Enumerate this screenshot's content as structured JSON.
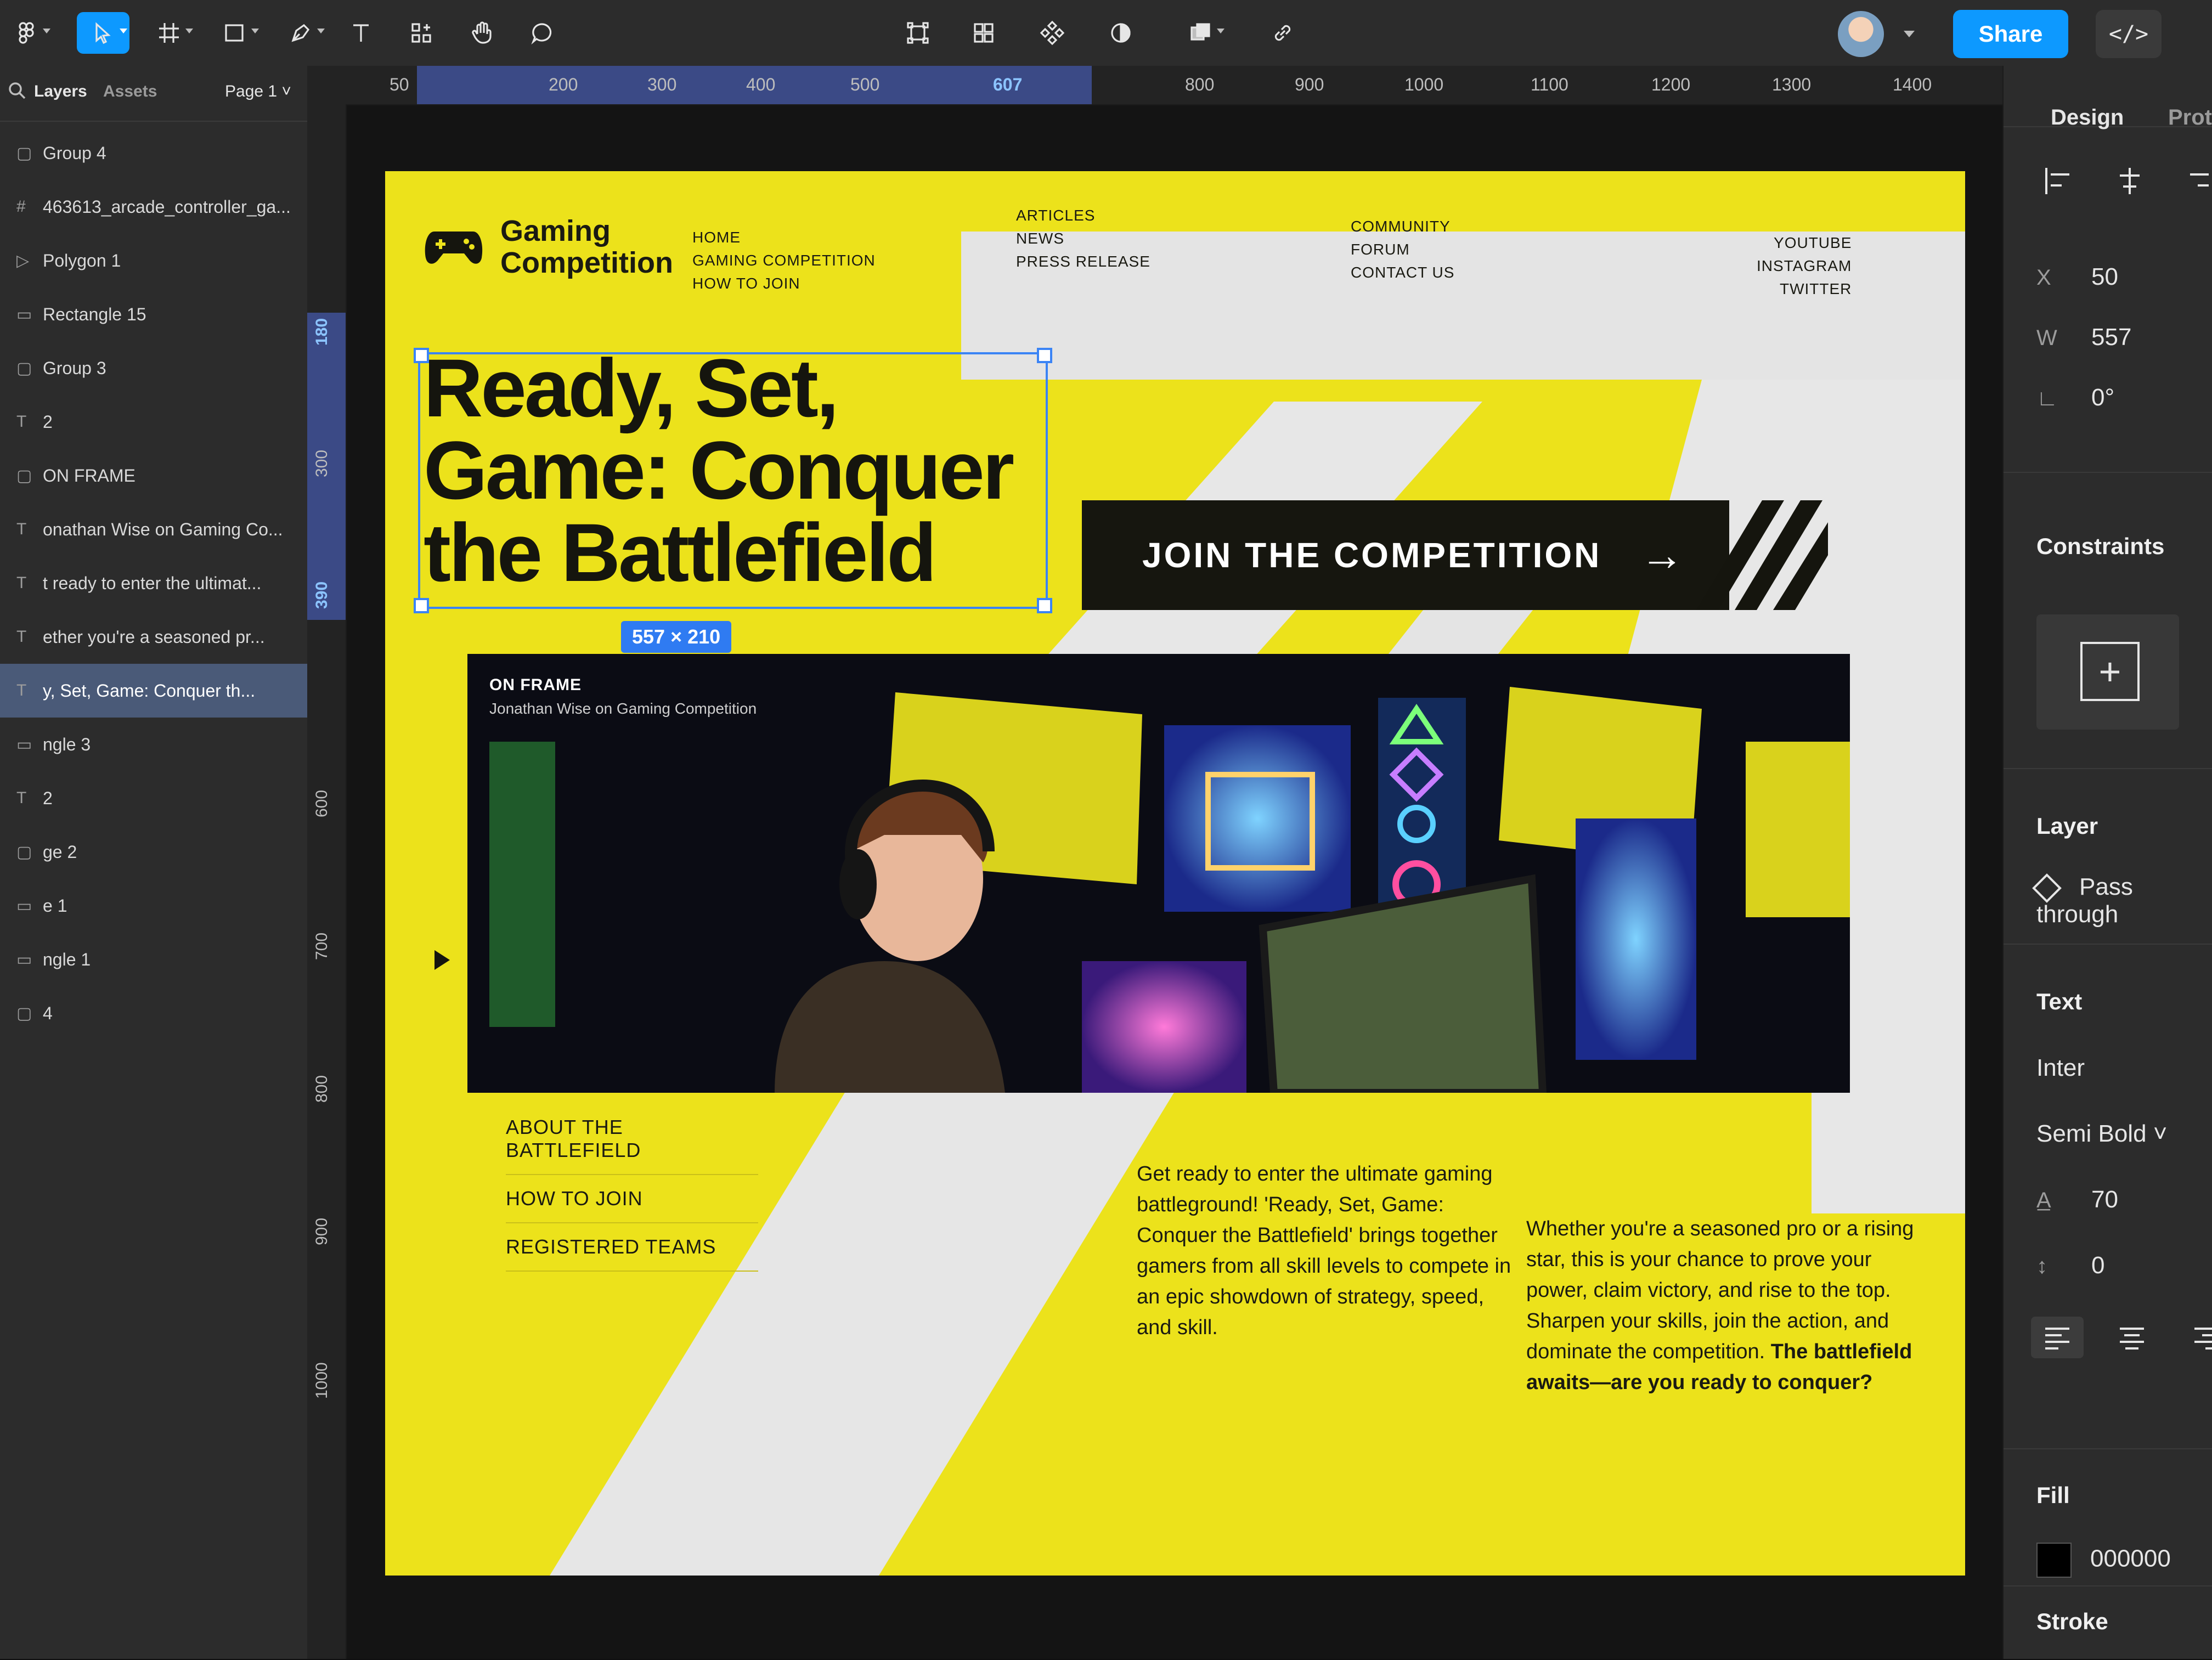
{
  "toolbar": {
    "share_label": "Share",
    "code_label": "</>"
  },
  "left_panel": {
    "tabs": [
      "Layers",
      "Assets"
    ],
    "page": "Page 1",
    "layers": [
      "Group 4",
      "463613_arcade_controller_ga...",
      "Polygon 1",
      "Rectangle 15",
      "Group 3",
      "2",
      "ON FRAME",
      "onathan Wise on Gaming Co...",
      "t ready to enter the ultimat...",
      "ether you're a seasoned pr...",
      "y, Set, Game: Conquer th...",
      "ngle 3",
      "2",
      "ge 2",
      "e 1",
      "ngle 1",
      "4"
    ]
  },
  "rulers": {
    "top": [
      "50",
      "200",
      "300",
      "400",
      "500",
      "607",
      "800",
      "900",
      "1000",
      "1100",
      "1200",
      "1300",
      "1400"
    ],
    "left": [
      "180",
      "300",
      "390",
      "600",
      "700",
      "800",
      "900",
      "1000"
    ]
  },
  "design": {
    "logo_text": "Gaming Competition",
    "nav": {
      "col1": [
        "HOME",
        "GAMING COMPETITION",
        "HOW TO JOIN"
      ],
      "col2": [
        "ARTICLES",
        "NEWS",
        "PRESS RELEASE"
      ],
      "col3": [
        "COMMUNITY",
        "FORUM",
        "CONTACT US"
      ],
      "col4": [
        "YOUTUBE",
        "INSTAGRAM",
        "TWITTER"
      ]
    },
    "headline": "Ready, Set, Game: Conquer the Battlefield",
    "size_tag": "557 × 210",
    "cta_label": "JOIN THE COMPETITION",
    "cta_arrow": "→",
    "photo_tag_title": "ON FRAME",
    "photo_tag_sub": "Jonathan Wise on Gaming Competition",
    "side_links": [
      "ABOUT THE BATTLEFIELD",
      "HOW TO JOIN",
      "REGISTERED TEAMS"
    ],
    "body_left": "Get ready to enter the ultimate gaming battleground! 'Ready, Set, Game: Conquer the Battlefield' brings together gamers from all skill levels to compete in an epic showdown of strategy, speed, and skill.",
    "body_right_plain": "Whether you're a seasoned pro or a rising star, this is your chance to prove your power, claim victory, and rise to the top. Sharpen your skills, join the action, and dominate the competition.",
    "body_right_bold": "The battlefield awaits—are you ready to conquer?"
  },
  "right_panel": {
    "tabs": [
      "Design",
      "Prot"
    ],
    "x_label": "X",
    "x_value": "50",
    "w_label": "W",
    "w_value": "557",
    "rotation": "0°",
    "constraints_title": "Constraints",
    "layer_title": "Layer",
    "blend_mode": "Pass through",
    "text_title": "Text",
    "font_family": "Inter",
    "font_weight": "Semi Bold",
    "font_size": "70",
    "letter_spacing": "0",
    "fill_title": "Fill",
    "fill_hex": "000000",
    "stroke_title": "Stroke"
  },
  "colors": {
    "accent": "#0d99ff",
    "frame_yellow": "#ece21b",
    "selection_blue": "#3b84f5",
    "ui_dark": "#2c2c2c"
  }
}
